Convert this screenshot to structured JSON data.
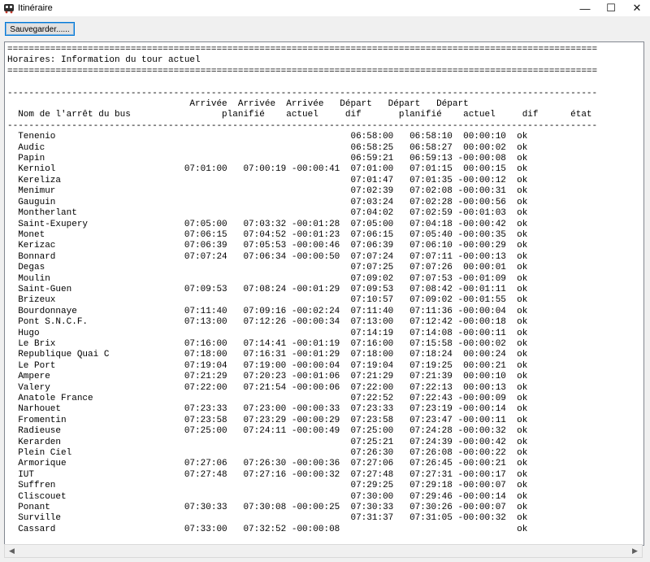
{
  "window": {
    "title": "Itinéraire",
    "icon": "bus-icon",
    "minimize_glyph": "—",
    "maximize_glyph": "☐",
    "close_glyph": "✕"
  },
  "toolbar": {
    "save_label": "Sauvegarder......"
  },
  "report": {
    "title": "Horaires: Information du tour actuel",
    "headers": {
      "line1": [
        "Arrivée",
        "Arrivée",
        "Arrivée",
        "Départ",
        "Départ",
        "Départ"
      ],
      "line2": [
        "Nom de l'arrêt du bus",
        "planifié",
        "actuel",
        "dif",
        "planifié",
        "actuel",
        "dif",
        "état"
      ]
    },
    "rows": [
      {
        "stop": "Tenenio",
        "arr_plan": "",
        "arr_act": "",
        "arr_dif": "",
        "dep_plan": "06:58:00",
        "dep_act": "06:58:10",
        "dep_dif": "00:00:10",
        "state": "ok"
      },
      {
        "stop": "Audic",
        "arr_plan": "",
        "arr_act": "",
        "arr_dif": "",
        "dep_plan": "06:58:25",
        "dep_act": "06:58:27",
        "dep_dif": "00:00:02",
        "state": "ok"
      },
      {
        "stop": "Papin",
        "arr_plan": "",
        "arr_act": "",
        "arr_dif": "",
        "dep_plan": "06:59:21",
        "dep_act": "06:59:13",
        "dep_dif": "-00:00:08",
        "state": "ok"
      },
      {
        "stop": "Kerniol",
        "arr_plan": "07:01:00",
        "arr_act": "07:00:19",
        "arr_dif": "-00:00:41",
        "dep_plan": "07:01:00",
        "dep_act": "07:01:15",
        "dep_dif": "00:00:15",
        "state": "ok"
      },
      {
        "stop": "Kereliza",
        "arr_plan": "",
        "arr_act": "",
        "arr_dif": "",
        "dep_plan": "07:01:47",
        "dep_act": "07:01:35",
        "dep_dif": "-00:00:12",
        "state": "ok"
      },
      {
        "stop": "Menimur",
        "arr_plan": "",
        "arr_act": "",
        "arr_dif": "",
        "dep_plan": "07:02:39",
        "dep_act": "07:02:08",
        "dep_dif": "-00:00:31",
        "state": "ok"
      },
      {
        "stop": "Gauguin",
        "arr_plan": "",
        "arr_act": "",
        "arr_dif": "",
        "dep_plan": "07:03:24",
        "dep_act": "07:02:28",
        "dep_dif": "-00:00:56",
        "state": "ok"
      },
      {
        "stop": "Montherlant",
        "arr_plan": "",
        "arr_act": "",
        "arr_dif": "",
        "dep_plan": "07:04:02",
        "dep_act": "07:02:59",
        "dep_dif": "-00:01:03",
        "state": "ok"
      },
      {
        "stop": "Saint-Exupery",
        "arr_plan": "07:05:00",
        "arr_act": "07:03:32",
        "arr_dif": "-00:01:28",
        "dep_plan": "07:05:00",
        "dep_act": "07:04:18",
        "dep_dif": "-00:00:42",
        "state": "ok"
      },
      {
        "stop": "Monet",
        "arr_plan": "07:06:15",
        "arr_act": "07:04:52",
        "arr_dif": "-00:01:23",
        "dep_plan": "07:06:15",
        "dep_act": "07:05:40",
        "dep_dif": "-00:00:35",
        "state": "ok"
      },
      {
        "stop": "Kerizac",
        "arr_plan": "07:06:39",
        "arr_act": "07:05:53",
        "arr_dif": "-00:00:46",
        "dep_plan": "07:06:39",
        "dep_act": "07:06:10",
        "dep_dif": "-00:00:29",
        "state": "ok"
      },
      {
        "stop": "Bonnard",
        "arr_plan": "07:07:24",
        "arr_act": "07:06:34",
        "arr_dif": "-00:00:50",
        "dep_plan": "07:07:24",
        "dep_act": "07:07:11",
        "dep_dif": "-00:00:13",
        "state": "ok"
      },
      {
        "stop": "Degas",
        "arr_plan": "",
        "arr_act": "",
        "arr_dif": "",
        "dep_plan": "07:07:25",
        "dep_act": "07:07:26",
        "dep_dif": "00:00:01",
        "state": "ok"
      },
      {
        "stop": "Moulin",
        "arr_plan": "",
        "arr_act": "",
        "arr_dif": "",
        "dep_plan": "07:09:02",
        "dep_act": "07:07:53",
        "dep_dif": "-00:01:09",
        "state": "ok"
      },
      {
        "stop": "Saint-Guen",
        "arr_plan": "07:09:53",
        "arr_act": "07:08:24",
        "arr_dif": "-00:01:29",
        "dep_plan": "07:09:53",
        "dep_act": "07:08:42",
        "dep_dif": "-00:01:11",
        "state": "ok"
      },
      {
        "stop": "Brizeux",
        "arr_plan": "",
        "arr_act": "",
        "arr_dif": "",
        "dep_plan": "07:10:57",
        "dep_act": "07:09:02",
        "dep_dif": "-00:01:55",
        "state": "ok"
      },
      {
        "stop": "Bourdonnaye",
        "arr_plan": "07:11:40",
        "arr_act": "07:09:16",
        "arr_dif": "-00:02:24",
        "dep_plan": "07:11:40",
        "dep_act": "07:11:36",
        "dep_dif": "-00:00:04",
        "state": "ok"
      },
      {
        "stop": "Pont S.N.C.F.",
        "arr_plan": "07:13:00",
        "arr_act": "07:12:26",
        "arr_dif": "-00:00:34",
        "dep_plan": "07:13:00",
        "dep_act": "07:12:42",
        "dep_dif": "-00:00:18",
        "state": "ok"
      },
      {
        "stop": "Hugo",
        "arr_plan": "",
        "arr_act": "",
        "arr_dif": "",
        "dep_plan": "07:14:19",
        "dep_act": "07:14:08",
        "dep_dif": "-00:00:11",
        "state": "ok"
      },
      {
        "stop": "Le Brix",
        "arr_plan": "07:16:00",
        "arr_act": "07:14:41",
        "arr_dif": "-00:01:19",
        "dep_plan": "07:16:00",
        "dep_act": "07:15:58",
        "dep_dif": "-00:00:02",
        "state": "ok"
      },
      {
        "stop": "Republique Quai C",
        "arr_plan": "07:18:00",
        "arr_act": "07:16:31",
        "arr_dif": "-00:01:29",
        "dep_plan": "07:18:00",
        "dep_act": "07:18:24",
        "dep_dif": "00:00:24",
        "state": "ok"
      },
      {
        "stop": "Le Port",
        "arr_plan": "07:19:04",
        "arr_act": "07:19:00",
        "arr_dif": "-00:00:04",
        "dep_plan": "07:19:04",
        "dep_act": "07:19:25",
        "dep_dif": "00:00:21",
        "state": "ok"
      },
      {
        "stop": "Ampere",
        "arr_plan": "07:21:29",
        "arr_act": "07:20:23",
        "arr_dif": "-00:01:06",
        "dep_plan": "07:21:29",
        "dep_act": "07:21:39",
        "dep_dif": "00:00:10",
        "state": "ok"
      },
      {
        "stop": "Valery",
        "arr_plan": "07:22:00",
        "arr_act": "07:21:54",
        "arr_dif": "-00:00:06",
        "dep_plan": "07:22:00",
        "dep_act": "07:22:13",
        "dep_dif": "00:00:13",
        "state": "ok"
      },
      {
        "stop": "Anatole France",
        "arr_plan": "",
        "arr_act": "",
        "arr_dif": "",
        "dep_plan": "07:22:52",
        "dep_act": "07:22:43",
        "dep_dif": "-00:00:09",
        "state": "ok"
      },
      {
        "stop": "Narhouet",
        "arr_plan": "07:23:33",
        "arr_act": "07:23:00",
        "arr_dif": "-00:00:33",
        "dep_plan": "07:23:33",
        "dep_act": "07:23:19",
        "dep_dif": "-00:00:14",
        "state": "ok"
      },
      {
        "stop": "Fromentin",
        "arr_plan": "07:23:58",
        "arr_act": "07:23:29",
        "arr_dif": "-00:00:29",
        "dep_plan": "07:23:58",
        "dep_act": "07:23:47",
        "dep_dif": "-00:00:11",
        "state": "ok"
      },
      {
        "stop": "Radieuse",
        "arr_plan": "07:25:00",
        "arr_act": "07:24:11",
        "arr_dif": "-00:00:49",
        "dep_plan": "07:25:00",
        "dep_act": "07:24:28",
        "dep_dif": "-00:00:32",
        "state": "ok"
      },
      {
        "stop": "Kerarden",
        "arr_plan": "",
        "arr_act": "",
        "arr_dif": "",
        "dep_plan": "07:25:21",
        "dep_act": "07:24:39",
        "dep_dif": "-00:00:42",
        "state": "ok"
      },
      {
        "stop": "Plein Ciel",
        "arr_plan": "",
        "arr_act": "",
        "arr_dif": "",
        "dep_plan": "07:26:30",
        "dep_act": "07:26:08",
        "dep_dif": "-00:00:22",
        "state": "ok"
      },
      {
        "stop": "Armorique",
        "arr_plan": "07:27:06",
        "arr_act": "07:26:30",
        "arr_dif": "-00:00:36",
        "dep_plan": "07:27:06",
        "dep_act": "07:26:45",
        "dep_dif": "-00:00:21",
        "state": "ok"
      },
      {
        "stop": "IUT",
        "arr_plan": "07:27:48",
        "arr_act": "07:27:16",
        "arr_dif": "-00:00:32",
        "dep_plan": "07:27:48",
        "dep_act": "07:27:31",
        "dep_dif": "-00:00:17",
        "state": "ok"
      },
      {
        "stop": "Suffren",
        "arr_plan": "",
        "arr_act": "",
        "arr_dif": "",
        "dep_plan": "07:29:25",
        "dep_act": "07:29:18",
        "dep_dif": "-00:00:07",
        "state": "ok"
      },
      {
        "stop": "Cliscouet",
        "arr_plan": "",
        "arr_act": "",
        "arr_dif": "",
        "dep_plan": "07:30:00",
        "dep_act": "07:29:46",
        "dep_dif": "-00:00:14",
        "state": "ok"
      },
      {
        "stop": "Ponant",
        "arr_plan": "07:30:33",
        "arr_act": "07:30:08",
        "arr_dif": "-00:00:25",
        "dep_plan": "07:30:33",
        "dep_act": "07:30:26",
        "dep_dif": "-00:00:07",
        "state": "ok"
      },
      {
        "stop": "Surville",
        "arr_plan": "",
        "arr_act": "",
        "arr_dif": "",
        "dep_plan": "07:31:37",
        "dep_act": "07:31:05",
        "dep_dif": "-00:00:32",
        "state": "ok"
      },
      {
        "stop": "Cassard",
        "arr_plan": "07:33:00",
        "arr_act": "07:32:52",
        "arr_dif": "-00:00:08",
        "dep_plan": "",
        "dep_act": "",
        "dep_dif": "",
        "state": "ok"
      }
    ]
  },
  "scrollbar": {
    "left_glyph": "◀",
    "right_glyph": "▶"
  }
}
